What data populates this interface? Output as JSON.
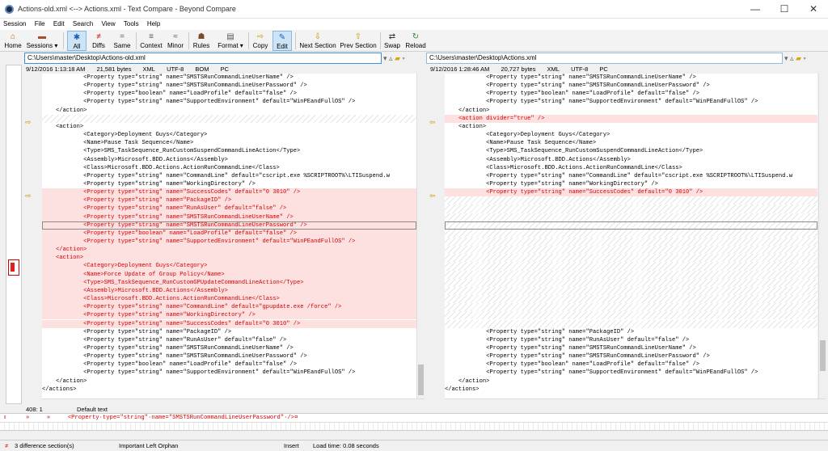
{
  "window": {
    "title": "Actions-old.xml <--> Actions.xml - Text Compare - Beyond Compare",
    "minimize": "—",
    "maximize": "☐",
    "close": "✕"
  },
  "menu": [
    "Session",
    "File",
    "Edit",
    "Search",
    "View",
    "Tools",
    "Help"
  ],
  "toolbar": {
    "home": "Home",
    "sessions": "Sessions",
    "all": "All",
    "diffs": "Diffs",
    "same": "Same",
    "context": "Context",
    "minor": "Minor",
    "rules": "Rules",
    "format": "Format",
    "copy": "Copy",
    "edit": "Edit",
    "next_section": "Next Section",
    "prev_section": "Prev Section",
    "swap": "Swap",
    "reload": "Reload"
  },
  "left": {
    "path": "C:\\Users\\master\\Desktop\\Actions-old.xml",
    "info": [
      "9/12/2016 1:13:18 AM",
      "21,581 bytes",
      "XML",
      "UTF-8",
      "BOM",
      "PC"
    ],
    "lines": [
      "            <Property type=\"string\" name=\"SMSTSRunCommandLineUserName\" />",
      "            <Property type=\"string\" name=\"SMSTSRunCommandLineUserPassword\" />",
      "            <Property type=\"boolean\" name=\"LoadProfile\" default=\"false\" />",
      "            <Property type=\"string\" name=\"SupportedEnvironment\" default=\"WinPEandFullOS\" />",
      "    </action>",
      "",
      "    <action>",
      "            <Category>Deployment Guys</Category>",
      "            <Name>Pause Task Sequence</Name>",
      "            <Type>SMS_TaskSequence_RunCustomSuspendCommandLineAction</Type>",
      "            <Assembly>Microsoft.BDD.Actions</Assembly>",
      "            <Class>Microsoft.BDD.Actions.ActionRunCommandLine</Class>",
      "            <Property type=\"string\" name=\"CommandLine\" default=\"cscript.exe %SCRIPTROOT%\\LTISuspend.w",
      "            <Property type=\"string\" name=\"WorkingDirectory\" />",
      "            <Property type=\"string\" name=\"SuccessCodes\" default=\"0 3010\" />",
      "            <Property type=\"string\" name=\"PackageID\" />",
      "            <Property type=\"string\" name=\"RunAsUser\" default=\"false\" />",
      "            <Property type=\"string\" name=\"SMSTSRunCommandLineUserName\" />",
      "            <Property type=\"string\" name=\"SMSTSRunCommandLineUserPassword\" />",
      "            <Property type=\"boolean\" name=\"LoadProfile\" default=\"false\" />",
      "            <Property type=\"string\" name=\"SupportedEnvironment\" default=\"WinPEandFullOS\" />",
      "    </action>",
      "    <action>",
      "            <Category>Deployment Guys</Category>",
      "            <Name>Force Update of Group Policy</Name>",
      "            <Type>SMS_TaskSequence_RunCustomGPUpdateCommandLineAction</Type>",
      "            <Assembly>Microsoft.BDD.Actions</Assembly>",
      "            <Class>Microsoft.BDD.Actions.ActionRunCommandLine</Class>",
      "            <Property type=\"string\" name=\"CommandLine\" default=\"gpupdate.exe /force\" />",
      "            <Property type=\"string\" name=\"WorkingDirectory\" />",
      "            <Property type=\"string\" name=\"SuccessCodes\" default=\"0 3010\" />",
      "            <Property type=\"string\" name=\"PackageID\" />",
      "            <Property type=\"string\" name=\"RunAsUser\" default=\"false\" />",
      "            <Property type=\"string\" name=\"SMSTSRunCommandLineUserName\" />",
      "            <Property type=\"string\" name=\"SMSTSRunCommandLineUserPassword\" />",
      "            <Property type=\"boolean\" name=\"LoadProfile\" default=\"false\" />",
      "            <Property type=\"string\" name=\"SupportedEnvironment\" default=\"WinPEandFullOS\" />",
      "    </action>",
      "</actions>"
    ],
    "diff_lines": [
      14,
      15,
      16,
      17,
      18,
      19,
      20,
      21,
      22,
      23,
      24,
      25,
      26,
      27,
      28,
      29,
      30
    ],
    "hatch_lines": [
      5
    ],
    "current_line": 18
  },
  "right": {
    "path": "C:\\Users\\master\\Desktop\\Actions.xml",
    "info": [
      "9/12/2016 1:28:46 AM",
      "20,727 bytes",
      "XML",
      "UTF-8",
      "PC"
    ],
    "lines": [
      "            <Property type=\"string\" name=\"SMSTSRunCommandLineUserName\" />",
      "            <Property type=\"string\" name=\"SMSTSRunCommandLineUserPassword\" />",
      "            <Property type=\"boolean\" name=\"LoadProfile\" default=\"false\" />",
      "            <Property type=\"string\" name=\"SupportedEnvironment\" default=\"WinPEandFullOS\" />",
      "    </action>",
      "    <action divider=\"true\" />",
      "    <action>",
      "            <Category>Deployment Guys</Category>",
      "            <Name>Pause Task Sequence</Name>",
      "            <Type>SMS_TaskSequence_RunCustomSuspendCommandLineAction</Type>",
      "            <Assembly>Microsoft.BDD.Actions</Assembly>",
      "            <Class>Microsoft.BDD.Actions.ActionRunCommandLine</Class>",
      "            <Property type=\"string\" name=\"CommandLine\" default=\"cscript.exe %SCRIPTROOT%\\LTISuspend.w",
      "            <Property type=\"string\" name=\"WorkingDirectory\" />",
      "            <Property type=\"string\" name=\"SuccessCodes\" default=\"0 3010\" />",
      "",
      "",
      "",
      "",
      "",
      "",
      "",
      "",
      "",
      "",
      "",
      "",
      "",
      "",
      "",
      "",
      "            <Property type=\"string\" name=\"PackageID\" />",
      "            <Property type=\"string\" name=\"RunAsUser\" default=\"false\" />",
      "            <Property type=\"string\" name=\"SMSTSRunCommandLineUserName\" />",
      "            <Property type=\"string\" name=\"SMSTSRunCommandLineUserPassword\" />",
      "            <Property type=\"boolean\" name=\"LoadProfile\" default=\"false\" />",
      "            <Property type=\"string\" name=\"SupportedEnvironment\" default=\"WinPEandFullOS\" />",
      "    </action>",
      "</actions>"
    ],
    "diff_lines": [
      5,
      14
    ],
    "hatch_lines": [
      15,
      16,
      17,
      18,
      19,
      20,
      21,
      22,
      23,
      24,
      25,
      26,
      27,
      28,
      29,
      30
    ],
    "current_line": 18
  },
  "position": "408: 1",
  "text_mode": "Default text",
  "edit_line_left": "»     »     <Property·type=\"string\"·name=\"SMSTSRunCommandLineUserPassword\"·/>¤",
  "status": {
    "diff_sections": "3 difference section(s)",
    "orphan": "Important Left Orphan",
    "insert": "Insert",
    "load_time": "Load time: 0.08 seconds"
  },
  "colors": {
    "diff_bg": "#fde0e0",
    "diff_text": "#d40000",
    "arrow": "#c49a00",
    "accent": "#3f8fd8"
  }
}
